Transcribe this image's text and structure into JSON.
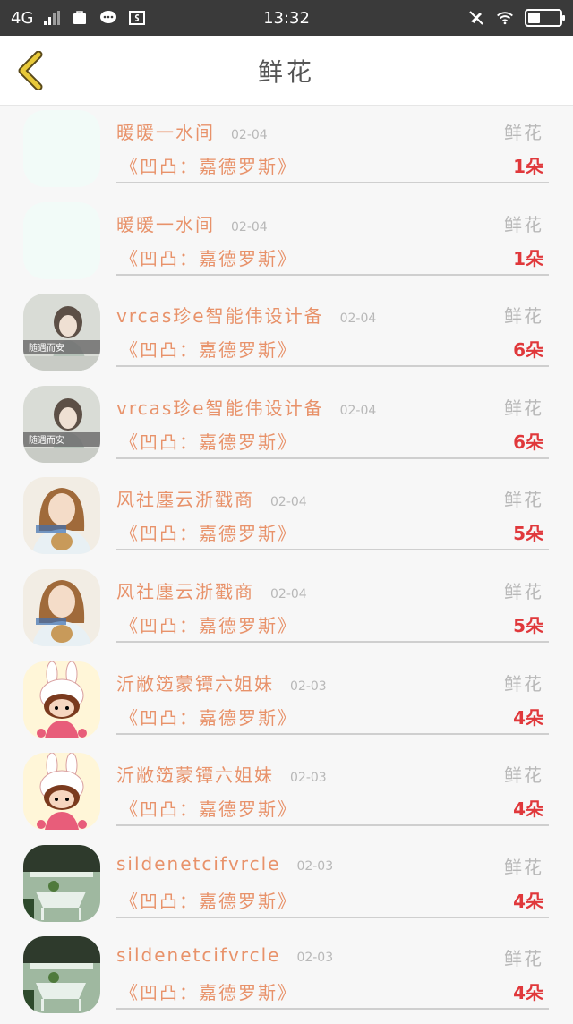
{
  "status_bar": {
    "network": "4G",
    "time": "13:32",
    "battery_level": 0.38
  },
  "header": {
    "title": "鲜花",
    "back_icon": "chevron-left-icon",
    "back_color": "#e8c93a"
  },
  "colors": {
    "name": "#e8926a",
    "meta": "#b8b8b8",
    "count": "#e0383b"
  },
  "items": [
    {
      "name": "暖暖一水间",
      "date": "02-04",
      "type": "鲜花",
      "description": "《凹凸：嘉德罗斯》",
      "count": "1朵",
      "avatar": "blank"
    },
    {
      "name": "暖暖一水间",
      "date": "02-04",
      "type": "鲜花",
      "description": "《凹凸：嘉德罗斯》",
      "count": "1朵",
      "avatar": "blank"
    },
    {
      "name": "vrcas珍e智能伟设计备",
      "date": "02-04",
      "type": "鲜花",
      "description": "《凹凸：嘉德罗斯》",
      "count": "6朵",
      "avatar": "girl-gray",
      "avatar_caption": "随遇而安"
    },
    {
      "name": "vrcas珍e智能伟设计备",
      "date": "02-04",
      "type": "鲜花",
      "description": "《凹凸：嘉德罗斯》",
      "count": "6朵",
      "avatar": "girl-gray",
      "avatar_caption": "随遇而安"
    },
    {
      "name": "风社廛云浙戳商",
      "date": "02-04",
      "type": "鲜花",
      "description": "《凹凸：嘉德罗斯》",
      "count": "5朵",
      "avatar": "girl-cupcake"
    },
    {
      "name": "风社廛云浙戳商",
      "date": "02-04",
      "type": "鲜花",
      "description": "《凹凸：嘉德罗斯》",
      "count": "5朵",
      "avatar": "girl-cupcake"
    },
    {
      "name": "沂敝笾蒙镡六姐妹",
      "date": "02-03",
      "type": "鲜花",
      "description": "《凹凸：嘉德罗斯》",
      "count": "4朵",
      "avatar": "bunny-cartoon"
    },
    {
      "name": "沂敝笾蒙镡六姐妹",
      "date": "02-03",
      "type": "鲜花",
      "description": "《凹凸：嘉德罗斯》",
      "count": "4朵",
      "avatar": "bunny-cartoon"
    },
    {
      "name": "sildenetcifvrcle",
      "date": "02-03",
      "type": "鲜花",
      "description": "《凹凸：嘉德罗斯》",
      "count": "4朵",
      "avatar": "garden-chair"
    },
    {
      "name": "sildenetcifvrcle",
      "date": "02-03",
      "type": "鲜花",
      "description": "《凹凸：嘉德罗斯》",
      "count": "4朵",
      "avatar": "garden-chair"
    }
  ]
}
